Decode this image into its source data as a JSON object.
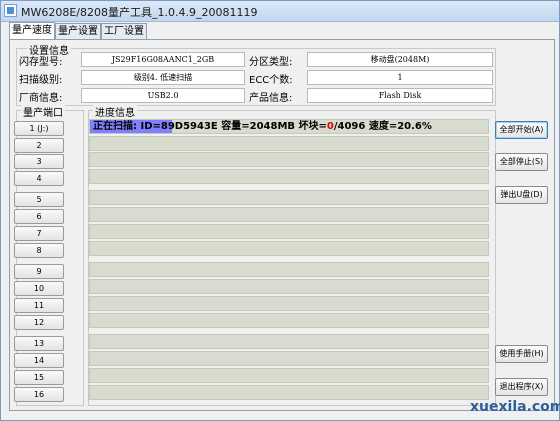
{
  "window": {
    "title": "MW6208E/8208量产工具_1.0.4.9_20081119"
  },
  "tabs": [
    {
      "label": "量产速度"
    },
    {
      "label": "量产设置"
    },
    {
      "label": "工厂设置"
    }
  ],
  "settings_info": {
    "legend": "设置信息",
    "flash_model_label": "闪存型号:",
    "flash_model_value": "JS29F16G08AANC1_2GB",
    "partition_type_label": "分区类型:",
    "partition_type_value": "移动盘(2048M)",
    "scan_level_label": "扫描级别:",
    "scan_level_value": "级别4. 低速扫描",
    "ecc_label": "ECC个数:",
    "ecc_value": "1",
    "vendor_label": "厂商信息:",
    "vendor_value": "USB2.0",
    "product_label": "产品信息:",
    "product_value": "Flash Disk"
  },
  "ports": {
    "legend": "量产端口",
    "buttons": [
      "1 (J:)",
      "2",
      "3",
      "4",
      "5",
      "6",
      "7",
      "8",
      "9",
      "10",
      "11",
      "12",
      "13",
      "14",
      "15",
      "16"
    ]
  },
  "progress": {
    "legend": "进度信息",
    "active": {
      "text_before": "正在扫描: ID=89D5943E 容量=2048MB 坏块=",
      "bad_blocks": "0",
      "text_after": "/4096 速度=20.6%",
      "percent": 20.6
    }
  },
  "actions": {
    "start_all": "全部开始(A)",
    "stop_all": "全部停止(S)",
    "eject": "弹出U盘(D)",
    "manual": "使用手册(H)",
    "exit": "退出程序(X)"
  },
  "watermark": "xuexila.com",
  "colors": {
    "progress_fill": "#8080ff",
    "empty_bar": "#d8dccf",
    "bad_blocks_color": "#e00000"
  }
}
